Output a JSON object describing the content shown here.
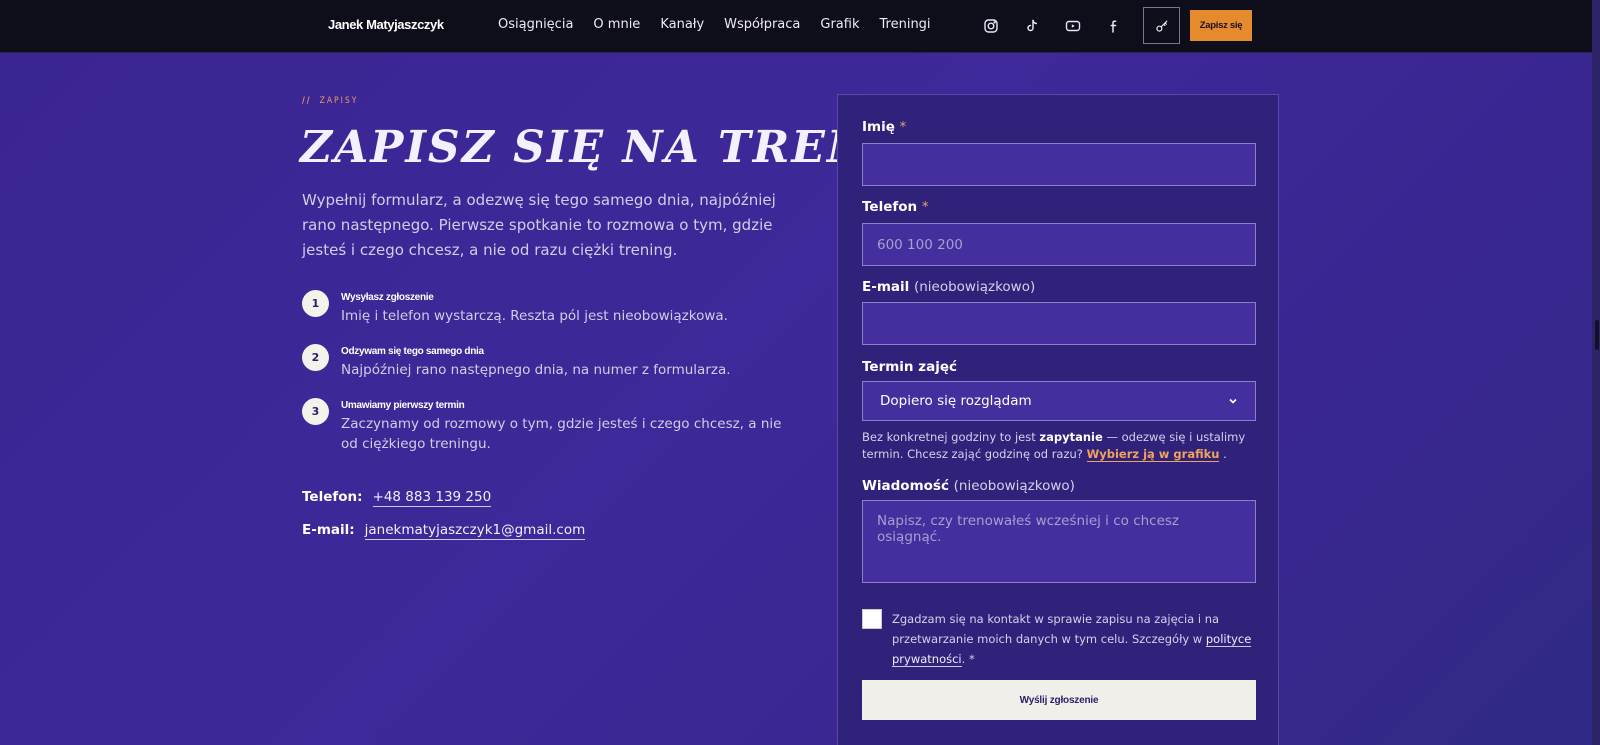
{
  "header": {
    "brand": "Janek Matyjaszczyk",
    "nav": [
      "Osiągnięcia",
      "O mnie",
      "Kanały",
      "Współpraca",
      "Grafik",
      "Treningi"
    ],
    "social_icons": [
      "instagram-icon",
      "tiktok-icon",
      "youtube-icon",
      "facebook-icon"
    ],
    "key_icon": "key-icon",
    "signup_label": "Zapisz się",
    "accent_color": "#e68a2e"
  },
  "hero": {
    "eyebrow_slashes": "//",
    "eyebrow": "ZAPISY",
    "title": "ZAPISZ SIĘ NA TRENING",
    "lead": "Wypełnij formularz, a odezwę się tego samego dnia, najpóźniej rano następnego. Pierwsze spotkanie to rozmowa o tym, gdzie jesteś i czego chcesz, a nie od razu ciężki trening."
  },
  "steps": [
    {
      "num": "1",
      "title": "Wysyłasz zgłoszenie",
      "desc": "Imię i telefon wystarczą. Reszta pól jest nieobowiązkowa."
    },
    {
      "num": "2",
      "title": "Odzywam się tego samego dnia",
      "desc": "Najpóźniej rano następnego dnia, na numer z formularza."
    },
    {
      "num": "3",
      "title": "Umawiamy pierwszy termin",
      "desc": "Zaczynamy od rozmowy o tym, gdzie jesteś i czego chcesz, a nie od ciężkiego treningu."
    }
  ],
  "contact": {
    "phone_label": "Telefon:",
    "phone": "+48 883 139 250",
    "email_label": "E-mail:",
    "email": "janekmatyjaszczyk1@gmail.com"
  },
  "form": {
    "name_label": "Imię",
    "name_req": "*",
    "name_value": "",
    "phone_label": "Telefon",
    "phone_req": "*",
    "phone_placeholder": "600 100 200",
    "email_label": "E-mail",
    "email_opt": "(nieobowiązkowo)",
    "email_value": "",
    "term_label": "Termin zajęć",
    "term_selected": "Dopiero się rozglądam",
    "helper_pre": "Bez konkretnej godziny to jest ",
    "helper_strong": "zapytanie",
    "helper_mid": " — odezwę się i ustalimy termin. Chcesz zająć godzinę od razu? ",
    "helper_link": "Wybierz ją w grafiku",
    "helper_post": " .",
    "message_label": "Wiadomość",
    "message_opt": "(nieobowiązkowo)",
    "message_placeholder": "Napisz, czy trenowałeś wcześniej i co chcesz osiągnąć.",
    "consent_pre": "Zgadzam się na kontakt w sprawie zapisu na zajęcia i na przetwarzanie moich danych w tym celu. Szczegóły w ",
    "consent_link": "polityce prywatności",
    "consent_post": ". *",
    "submit_label": "Wyślij zgłoszenie"
  }
}
